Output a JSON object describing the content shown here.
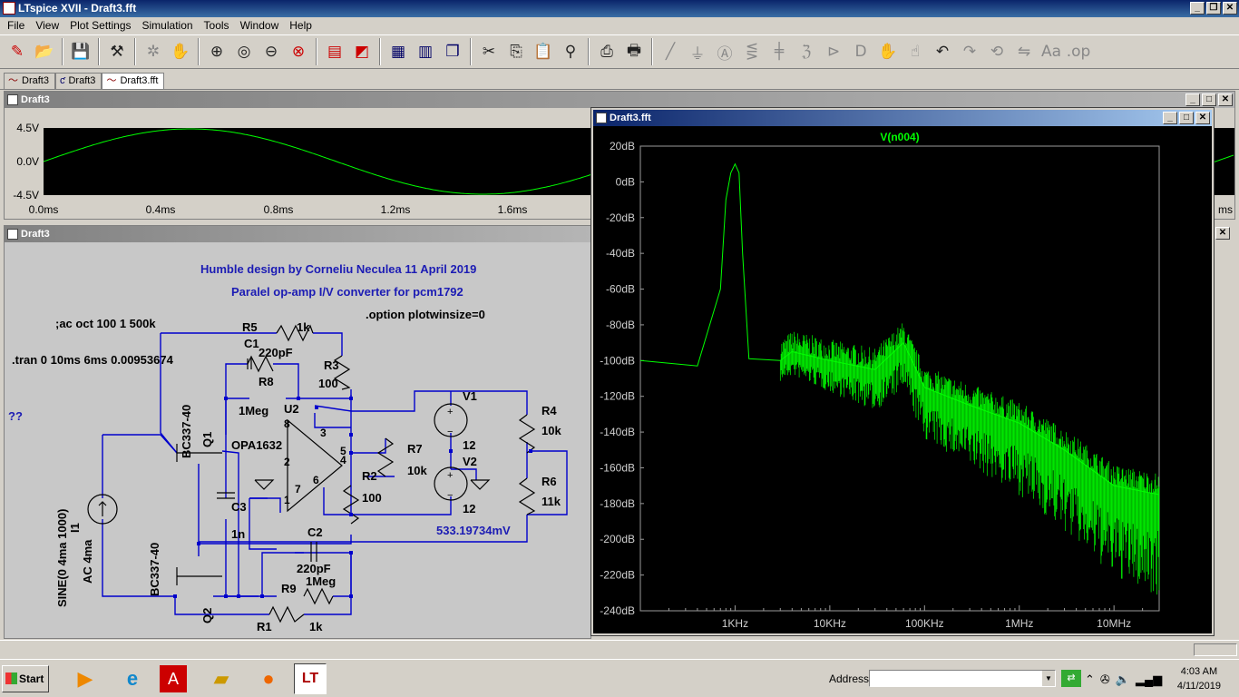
{
  "window": {
    "title": "LTspice XVII - Draft3.fft"
  },
  "menu": [
    "File",
    "View",
    "Plot Settings",
    "Simulation",
    "Tools",
    "Window",
    "Help"
  ],
  "toolbar_icons": [
    "new-schematic-icon",
    "open-icon",
    "save-icon",
    "control-panel-icon",
    "run-icon",
    "halt-icon",
    "zoom-in-icon",
    "zoom-pan-icon",
    "zoom-out-icon",
    "zoom-cancel-icon",
    "autorange-icon",
    "tile-vertical-icon",
    "tile-horizontal-icon",
    "cascade-icon",
    "close-icon",
    "cut-icon",
    "copy-icon",
    "paste-icon",
    "find-icon",
    "print-icon",
    "print-setup-icon",
    "wire-icon",
    "ground-icon",
    "label-icon",
    "resistor-icon",
    "capacitor-icon",
    "inductor-icon",
    "diode-icon",
    "component-icon",
    "move-icon",
    "drag-icon",
    "undo-icon",
    "redo-icon",
    "rotate-icon",
    "mirror-icon",
    "text-icon",
    "spice-directive-icon"
  ],
  "tabs": [
    "Draft3",
    "Draft3",
    "Draft3.fft"
  ],
  "transient_window": {
    "title": "Draft3",
    "y_ticks": [
      "4.5V",
      "0.0V",
      "-4.5V"
    ],
    "x_ticks": [
      "0.0ms",
      "0.4ms",
      "0.8ms",
      "1.2ms",
      "1.6ms"
    ],
    "x_cut_label": "ms"
  },
  "schematic_window": {
    "title": "Draft3",
    "texts": {
      "line1": "Humble design by Corneliu Neculea 11 April 2019",
      "line2": "Paralel op-amp I/V converter  for pcm1792",
      "option": ".option plotwinsize=0",
      "ac": ";ac oct 100 1 500k",
      "tran": ".tran 0 10ms 6ms 0.00953674",
      "qq": "??",
      "voltage": "533.19734mV"
    },
    "components": {
      "R5": "R5",
      "R5v": "1k",
      "C1": "C1",
      "C1v": "220pF",
      "R8": "R8",
      "R8v": "1Meg",
      "R3": "R3",
      "R3v": "100",
      "U2": "U2",
      "U2v": "OPA1632",
      "Q1": "Q1",
      "Q1v": "BC337-40",
      "Q2": "Q2",
      "Q2v": "BC337-40",
      "C3": "C3",
      "C3v": "1n",
      "C2": "C2",
      "C2v": "220pF",
      "R9": "R9",
      "R9v": "1Meg",
      "R1": "R1",
      "R1v": "1k",
      "R7": "R7",
      "R7v": "10k",
      "R2": "R2",
      "R2v": "100",
      "V1": "V1",
      "V1v": "12",
      "V2": "V2",
      "V2v": "12",
      "R4": "R4",
      "R4v": "10k",
      "R6": "R6",
      "R6v": "11k",
      "I1": "I1",
      "I1a": "SINE(0 4ma 1000)",
      "I1b": "AC 4ma",
      "pins": [
        "8",
        "3",
        "5",
        "4",
        "2",
        "7",
        "1",
        "6"
      ]
    }
  },
  "fft_window": {
    "title": "Draft3.fft",
    "trace_name": "V(n004)",
    "trace_color": "#00ff00"
  },
  "chart_data": {
    "type": "line",
    "title": "V(n004)",
    "xlabel": "",
    "ylabel": "",
    "x_scale": "log",
    "xlim": [
      100,
      30000000
    ],
    "ylim": [
      -240,
      20
    ],
    "y_ticks": [
      "20dB",
      "0dB",
      "-20dB",
      "-40dB",
      "-60dB",
      "-80dB",
      "-100dB",
      "-120dB",
      "-140dB",
      "-160dB",
      "-180dB",
      "-200dB",
      "-220dB",
      "-240dB"
    ],
    "x_ticks": [
      "1KHz",
      "10KHz",
      "100KHz",
      "1MHz",
      "10MHz"
    ],
    "series": [
      {
        "name": "V(n004)",
        "x": [
          100,
          400,
          700,
          800,
          900,
          1000,
          1100,
          1200,
          1400,
          3000,
          4000,
          10000,
          30000,
          60000,
          100000,
          300000,
          1000000,
          3000000,
          10000000,
          30000000
        ],
        "y": [
          -100,
          -103,
          -60,
          -10,
          5,
          10,
          5,
          -40,
          -99,
          -100,
          -95,
          -100,
          -105,
          -90,
          -115,
          -125,
          -135,
          -150,
          -170,
          -175
        ]
      }
    ],
    "grid": false,
    "legend": "top-center"
  },
  "taskbar": {
    "start": "Start",
    "address_label": "Address",
    "time": "4:03 AM",
    "date": "4/11/2019"
  },
  "colors": {
    "trace": "#00ff00",
    "schematic_wire": "#0000ff",
    "schematic_text": "#000000",
    "highlight_text": "#1c1cb4"
  }
}
